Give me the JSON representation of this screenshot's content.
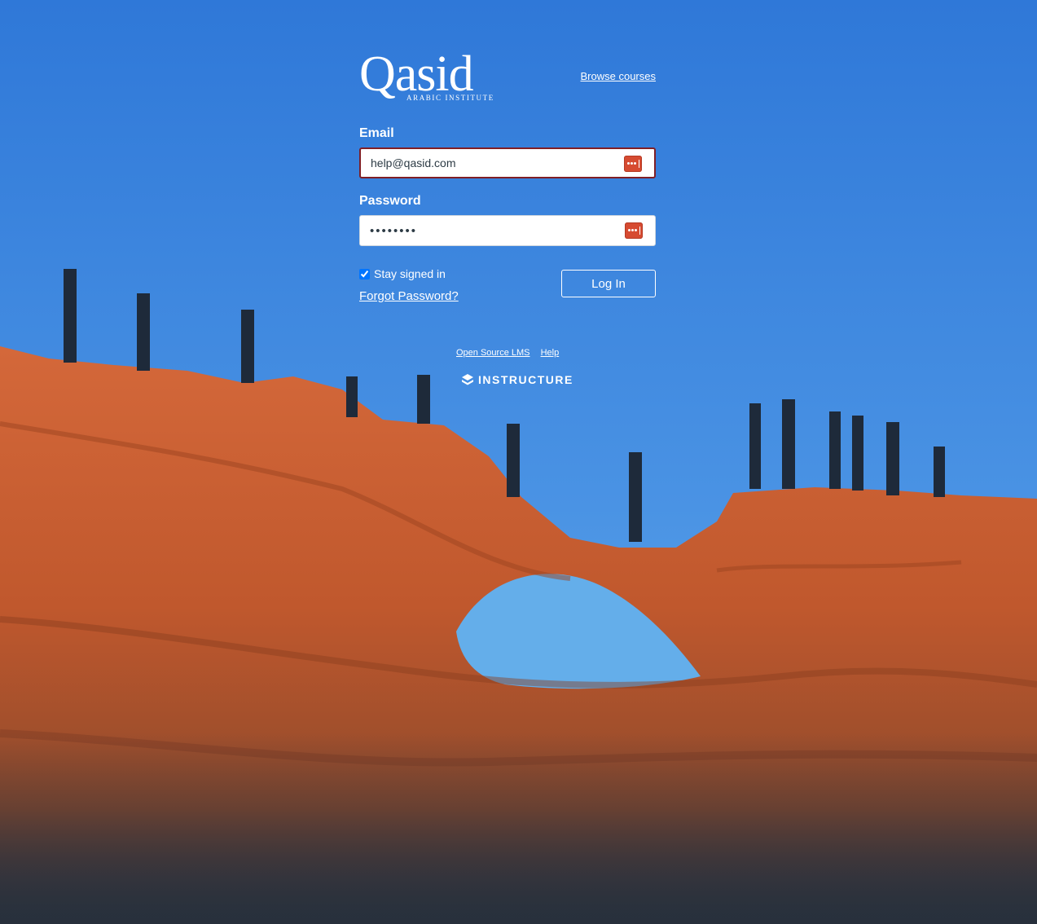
{
  "brand": {
    "logo_text": "Qasid",
    "logo_subtitle": "ARABIC INSTITUTE"
  },
  "header": {
    "browse_courses": "Browse courses"
  },
  "form": {
    "email_label": "Email",
    "email_value": "help@qasid.com",
    "password_label": "Password",
    "password_value": "password",
    "stay_signed_in_label": "Stay signed in",
    "stay_signed_in_checked": true,
    "forgot_password": "Forgot Password?",
    "login_button": "Log In"
  },
  "footer": {
    "open_source": "Open Source LMS",
    "help": "Help",
    "vendor": "INSTRUCTURE"
  },
  "theme": {
    "sky": "#3f86d9",
    "rock": "#c4582a",
    "focus_border": "#7f1f26",
    "password_manager_icon": "#d64b31"
  },
  "icons": {
    "input_icon": "password-manager-icon",
    "vendor_icon": "instructure-logo-icon"
  }
}
